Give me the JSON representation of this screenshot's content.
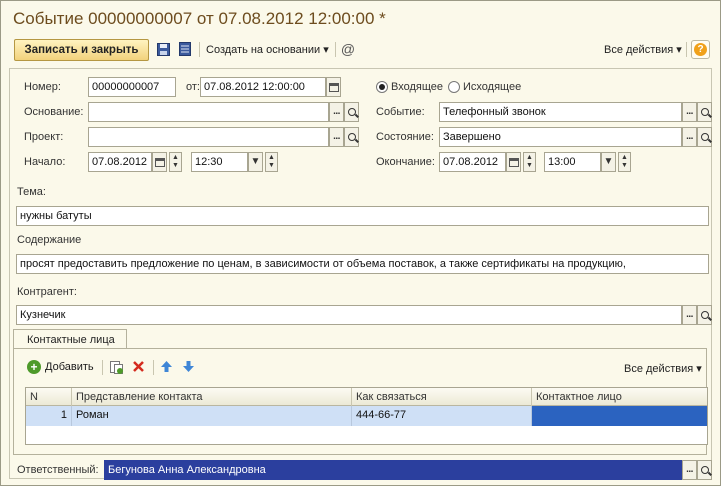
{
  "window": {
    "title": "Событие 00000000007 от 07.08.2012 12:00:00 *"
  },
  "toolbar": {
    "save_close_label": "Записать и закрыть",
    "create_based_label": "Создать на основании",
    "all_actions_label": "Все действия",
    "help_glyph": "?",
    "at_glyph": "@"
  },
  "form": {
    "number_label": "Номер:",
    "number_value": "00000000007",
    "from_label": "от:",
    "date_value": "07.08.2012 12:00:00",
    "incoming_label": "Входящее",
    "outgoing_label": "Исходящее",
    "direction_selected": "incoming",
    "basis_label": "Основание:",
    "basis_value": "",
    "event_label": "Событие:",
    "event_value": "Телефонный звонок",
    "project_label": "Проект:",
    "project_value": "",
    "state_label": "Состояние:",
    "state_value": "Завершено",
    "start_label": "Начало:",
    "start_date": "07.08.2012",
    "start_time": "12:30",
    "end_label": "Окончание:",
    "end_date": "07.08.2012",
    "end_time": "13:00",
    "topic_label": "Тема:",
    "topic_value": "нужны батуты",
    "content_label": "Содержание",
    "content_value": "просят предоставить предложение по ценам, в зависимости от объема поставок, а также сертификаты на продукцию,",
    "counterparty_label": "Контрагент:",
    "counterparty_value": "Кузнечик",
    "responsible_label": "Ответственный:",
    "responsible_value": "Бегунова Анна Александровна"
  },
  "contacts": {
    "tab_label": "Контактные лица",
    "add_label": "Добавить",
    "all_actions_label": "Все действия",
    "columns": [
      "N",
      "Представление контакта",
      "Как связаться",
      "Контактное лицо"
    ],
    "rows": [
      {
        "n": "1",
        "name": "Роман",
        "contact": "444-66-77",
        "person": ""
      }
    ]
  },
  "colors": {
    "background": "#fbf9ea",
    "title": "#6d4c1e",
    "selection": "#2b3f9e",
    "row_highlight": "#cfe0f6"
  }
}
